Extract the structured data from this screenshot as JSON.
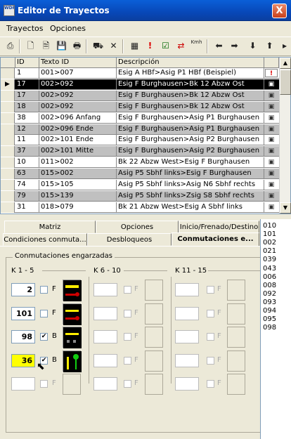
{
  "window": {
    "title": "Editor de Trayectos",
    "close_label": "X"
  },
  "menu": [
    {
      "label": "Trayectos"
    },
    {
      "label": "Opciones"
    }
  ],
  "toolbar_icons": [
    "print-icon",
    "new-icon",
    "open-icon",
    "save-icon",
    "printer-icon",
    "route-icon",
    "delete-icon",
    "grid-icon",
    "alert-icon",
    "check-icon",
    "swap-icon",
    "kmh-icon",
    "left-arrow-icon",
    "right-arrow-icon",
    "down-arrow-icon",
    "up-arrow-icon"
  ],
  "toolbar": {
    "kmh_label": "Kmh"
  },
  "table": {
    "headers": [
      "ID",
      "Texto ID",
      "Descripción"
    ],
    "rows": [
      {
        "id": "1",
        "texto": "001>007",
        "desc": "Esig A HBf>Asig P1 HBf (Beispiel)",
        "style": "white",
        "icon": "!"
      },
      {
        "id": "17",
        "texto": "002>092",
        "desc": "Esig F Burghausen>Bk 12  Abzw Ost",
        "style": "sel",
        "icon": "▣"
      },
      {
        "id": "17",
        "texto": "002>092",
        "desc": "Esig F Burghausen>Bk 12  Abzw Ost",
        "style": "gray",
        "icon": "▣"
      },
      {
        "id": "18",
        "texto": "002>092",
        "desc": "Esig F Burghausen>Bk 12  Abzw Ost",
        "style": "gray",
        "icon": "▣"
      },
      {
        "id": "38",
        "texto": "002>096 Anfang",
        "desc": "Esig F Burghausen>Asig P1 Burghausen",
        "style": "white",
        "icon": "▣"
      },
      {
        "id": "12",
        "texto": "002>096 Ende",
        "desc": "Esig F Burghausen>Asig P1 Burghausen",
        "style": "gray",
        "icon": "▣"
      },
      {
        "id": "11",
        "texto": "002>101 Ende",
        "desc": "Esig F Burghausen>Asig P2 Burghausen",
        "style": "white",
        "icon": "▣"
      },
      {
        "id": "37",
        "texto": "002>101 Mitte",
        "desc": "Esig F Burghausen>Asig P2 Burghausen",
        "style": "gray",
        "icon": "▣"
      },
      {
        "id": "10",
        "texto": "011>002",
        "desc": "Bk 22 Abzw West>Esig F Burghausen",
        "style": "white",
        "icon": "▣"
      },
      {
        "id": "63",
        "texto": "015>002",
        "desc": "Asig P5 Sbhf links>Esig F Burghausen",
        "style": "gray",
        "icon": "▣"
      },
      {
        "id": "74",
        "texto": "015>105",
        "desc": "Asig P5 Sbhf links>Asig N6 Sbhf rechts",
        "style": "white",
        "icon": "▣"
      },
      {
        "id": "79",
        "texto": "015>139",
        "desc": "Asig P5 Sbhf links>Zsig S8 Sbhf rechts",
        "style": "gray",
        "icon": "▣"
      },
      {
        "id": "31",
        "texto": "018>079",
        "desc": "Bk 21 Abzw West>Esig A Sbhf links",
        "style": "white",
        "icon": "▣"
      }
    ]
  },
  "tabs_row1": [
    "Matriz",
    "Opciones",
    "Inicio/Frenado/Destino"
  ],
  "tabs_row2": [
    "Condiciones conmuta...",
    "Desbloqueos",
    "Conmutaciones e..."
  ],
  "group": {
    "title": "Conmutaciones engarzadas",
    "k1": "K 1 - 5",
    "k2": "K 6 - 10",
    "k3": "K 11 - 15",
    "entries": [
      {
        "num": "2",
        "checked": false,
        "flag": "F"
      },
      {
        "num": "101",
        "checked": false,
        "flag": "F"
      },
      {
        "num": "98",
        "checked": true,
        "flag": "B"
      },
      {
        "num": "36",
        "checked": true,
        "flag": "B"
      },
      {
        "num": "",
        "checked": false,
        "flag": "F"
      }
    ],
    "disabled_flag": "F"
  },
  "side_list": [
    "010",
    "101",
    "002",
    "021",
    "039",
    "043",
    "006",
    "008",
    "092",
    "093",
    "094",
    "095",
    "098"
  ],
  "colors": {
    "title_bar": "#0a5fd8",
    "selected_row": "#000000",
    "highlight_yellow": "#ffff00"
  }
}
